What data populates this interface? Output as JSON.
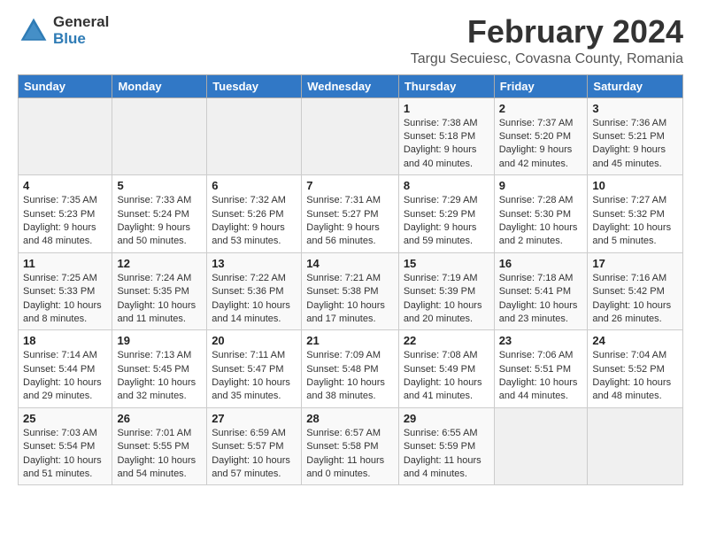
{
  "app": {
    "logo_general": "General",
    "logo_blue": "Blue"
  },
  "header": {
    "title": "February 2024",
    "subtitle": "Targu Secuiesc, Covasna County, Romania"
  },
  "calendar": {
    "days_of_week": [
      "Sunday",
      "Monday",
      "Tuesday",
      "Wednesday",
      "Thursday",
      "Friday",
      "Saturday"
    ],
    "weeks": [
      [
        {
          "day": "",
          "info": ""
        },
        {
          "day": "",
          "info": ""
        },
        {
          "day": "",
          "info": ""
        },
        {
          "day": "",
          "info": ""
        },
        {
          "day": "1",
          "info": "Sunrise: 7:38 AM\nSunset: 5:18 PM\nDaylight: 9 hours\nand 40 minutes."
        },
        {
          "day": "2",
          "info": "Sunrise: 7:37 AM\nSunset: 5:20 PM\nDaylight: 9 hours\nand 42 minutes."
        },
        {
          "day": "3",
          "info": "Sunrise: 7:36 AM\nSunset: 5:21 PM\nDaylight: 9 hours\nand 45 minutes."
        }
      ],
      [
        {
          "day": "4",
          "info": "Sunrise: 7:35 AM\nSunset: 5:23 PM\nDaylight: 9 hours\nand 48 minutes."
        },
        {
          "day": "5",
          "info": "Sunrise: 7:33 AM\nSunset: 5:24 PM\nDaylight: 9 hours\nand 50 minutes."
        },
        {
          "day": "6",
          "info": "Sunrise: 7:32 AM\nSunset: 5:26 PM\nDaylight: 9 hours\nand 53 minutes."
        },
        {
          "day": "7",
          "info": "Sunrise: 7:31 AM\nSunset: 5:27 PM\nDaylight: 9 hours\nand 56 minutes."
        },
        {
          "day": "8",
          "info": "Sunrise: 7:29 AM\nSunset: 5:29 PM\nDaylight: 9 hours\nand 59 minutes."
        },
        {
          "day": "9",
          "info": "Sunrise: 7:28 AM\nSunset: 5:30 PM\nDaylight: 10 hours\nand 2 minutes."
        },
        {
          "day": "10",
          "info": "Sunrise: 7:27 AM\nSunset: 5:32 PM\nDaylight: 10 hours\nand 5 minutes."
        }
      ],
      [
        {
          "day": "11",
          "info": "Sunrise: 7:25 AM\nSunset: 5:33 PM\nDaylight: 10 hours\nand 8 minutes."
        },
        {
          "day": "12",
          "info": "Sunrise: 7:24 AM\nSunset: 5:35 PM\nDaylight: 10 hours\nand 11 minutes."
        },
        {
          "day": "13",
          "info": "Sunrise: 7:22 AM\nSunset: 5:36 PM\nDaylight: 10 hours\nand 14 minutes."
        },
        {
          "day": "14",
          "info": "Sunrise: 7:21 AM\nSunset: 5:38 PM\nDaylight: 10 hours\nand 17 minutes."
        },
        {
          "day": "15",
          "info": "Sunrise: 7:19 AM\nSunset: 5:39 PM\nDaylight: 10 hours\nand 20 minutes."
        },
        {
          "day": "16",
          "info": "Sunrise: 7:18 AM\nSunset: 5:41 PM\nDaylight: 10 hours\nand 23 minutes."
        },
        {
          "day": "17",
          "info": "Sunrise: 7:16 AM\nSunset: 5:42 PM\nDaylight: 10 hours\nand 26 minutes."
        }
      ],
      [
        {
          "day": "18",
          "info": "Sunrise: 7:14 AM\nSunset: 5:44 PM\nDaylight: 10 hours\nand 29 minutes."
        },
        {
          "day": "19",
          "info": "Sunrise: 7:13 AM\nSunset: 5:45 PM\nDaylight: 10 hours\nand 32 minutes."
        },
        {
          "day": "20",
          "info": "Sunrise: 7:11 AM\nSunset: 5:47 PM\nDaylight: 10 hours\nand 35 minutes."
        },
        {
          "day": "21",
          "info": "Sunrise: 7:09 AM\nSunset: 5:48 PM\nDaylight: 10 hours\nand 38 minutes."
        },
        {
          "day": "22",
          "info": "Sunrise: 7:08 AM\nSunset: 5:49 PM\nDaylight: 10 hours\nand 41 minutes."
        },
        {
          "day": "23",
          "info": "Sunrise: 7:06 AM\nSunset: 5:51 PM\nDaylight: 10 hours\nand 44 minutes."
        },
        {
          "day": "24",
          "info": "Sunrise: 7:04 AM\nSunset: 5:52 PM\nDaylight: 10 hours\nand 48 minutes."
        }
      ],
      [
        {
          "day": "25",
          "info": "Sunrise: 7:03 AM\nSunset: 5:54 PM\nDaylight: 10 hours\nand 51 minutes."
        },
        {
          "day": "26",
          "info": "Sunrise: 7:01 AM\nSunset: 5:55 PM\nDaylight: 10 hours\nand 54 minutes."
        },
        {
          "day": "27",
          "info": "Sunrise: 6:59 AM\nSunset: 5:57 PM\nDaylight: 10 hours\nand 57 minutes."
        },
        {
          "day": "28",
          "info": "Sunrise: 6:57 AM\nSunset: 5:58 PM\nDaylight: 11 hours\nand 0 minutes."
        },
        {
          "day": "29",
          "info": "Sunrise: 6:55 AM\nSunset: 5:59 PM\nDaylight: 11 hours\nand 4 minutes."
        },
        {
          "day": "",
          "info": ""
        },
        {
          "day": "",
          "info": ""
        }
      ]
    ]
  }
}
